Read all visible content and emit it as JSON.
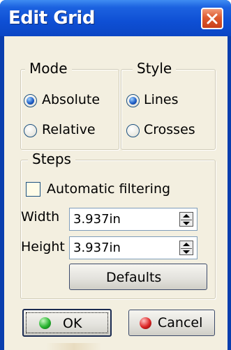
{
  "window": {
    "title": "Edit Grid"
  },
  "mode": {
    "label": "Mode",
    "options": [
      {
        "label": "Absolute",
        "selected": true
      },
      {
        "label": "Relative",
        "selected": false
      }
    ]
  },
  "style": {
    "label": "Style",
    "options": [
      {
        "label": "Lines",
        "selected": true
      },
      {
        "label": "Crosses",
        "selected": false
      }
    ]
  },
  "steps": {
    "label": "Steps",
    "automatic_filtering": {
      "label": "Automatic filtering",
      "checked": false
    },
    "width": {
      "label": "Width",
      "value": "3.937in"
    },
    "height": {
      "label": "Height",
      "value": "3.937in"
    },
    "defaults_label": "Defaults"
  },
  "buttons": {
    "ok": "OK",
    "cancel": "Cancel"
  },
  "colors": {
    "titlebar": "#0b46c4",
    "client": "#f3efe0",
    "ok_dot": "#1fae2b",
    "cancel_dot": "#d42020"
  }
}
